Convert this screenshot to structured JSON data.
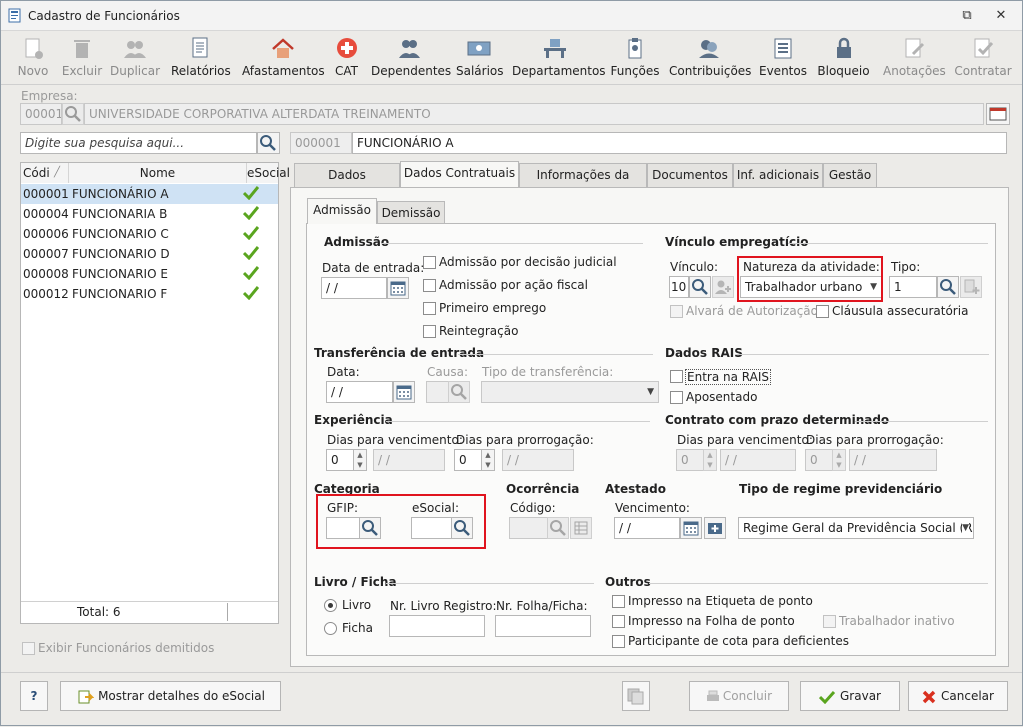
{
  "window": {
    "title": "Cadastro de Funcionários"
  },
  "toolbar": {
    "items": [
      {
        "label": "Novo",
        "icon": "new-icon",
        "enabled": false
      },
      {
        "label": "Excluir",
        "icon": "trash-icon",
        "enabled": false
      },
      {
        "label": "Duplicar",
        "icon": "duplicate-icon",
        "enabled": false
      },
      {
        "label": "Relatórios",
        "icon": "report-icon",
        "enabled": true
      },
      {
        "label": "Afastamentos",
        "icon": "house-icon",
        "enabled": true
      },
      {
        "label": "CAT",
        "icon": "cross-icon",
        "enabled": true
      },
      {
        "label": "Dependentes",
        "icon": "people-icon",
        "enabled": true
      },
      {
        "label": "Salários",
        "icon": "money-icon",
        "enabled": true
      },
      {
        "label": "Departamentos",
        "icon": "desk-icon",
        "enabled": true
      },
      {
        "label": "Funções",
        "icon": "badge-icon",
        "enabled": true
      },
      {
        "label": "Contribuições",
        "icon": "contribution-icon",
        "enabled": true
      },
      {
        "label": "Eventos",
        "icon": "list-icon",
        "enabled": true
      },
      {
        "label": "Bloqueio",
        "icon": "lock-icon",
        "enabled": true
      },
      {
        "label": "Anotações",
        "icon": "note-icon",
        "enabled": false
      },
      {
        "label": "Contratar",
        "icon": "hire-icon",
        "enabled": false
      }
    ]
  },
  "empresa": {
    "label": "Empresa:",
    "code": "00001",
    "name": "UNIVERSIDADE CORPORATIVA ALTERDATA TREINAMENTO"
  },
  "search": {
    "placeholder": "Digite sua pesquisa aqui..."
  },
  "employee": {
    "code": "000001",
    "name": "FUNCIONÁRIO A"
  },
  "grid": {
    "headers": [
      "Códi",
      "Nome",
      "eSocial"
    ],
    "rows": [
      {
        "code": "000001",
        "name": "FUNCIONÁRIO A",
        "esocial": true
      },
      {
        "code": "000004",
        "name": "FUNCIONARIA B",
        "esocial": true
      },
      {
        "code": "000006",
        "name": "FUNCIONARIO C",
        "esocial": true
      },
      {
        "code": "000007",
        "name": "FUNCIONARIO D",
        "esocial": true
      },
      {
        "code": "000008",
        "name": "FUNCIONARIO E",
        "esocial": true
      },
      {
        "code": "000012",
        "name": "FUNCIONARIO F",
        "esocial": true
      }
    ],
    "total": "Total: 6"
  },
  "exibir_demitidos": "Exibir Funcionários demitidos",
  "tabs": [
    "Dados Cadastrais",
    "Dados Contratuais",
    "Informações da folha",
    "Documentos",
    "Inf. adicionais",
    "Gestão"
  ],
  "subtabs": [
    "Admissão",
    "Demissão"
  ],
  "admissao": {
    "title": "Admissão",
    "data_label": "Data de entrada:",
    "date_value": " / /",
    "checks": [
      "Admissão por decisão judicial",
      "Admissão por ação fiscal",
      "Primeiro emprego",
      "Reintegração"
    ]
  },
  "vinculo": {
    "title": "Vínculo empregatício",
    "vinculo_label": "Vínculo:",
    "vinculo_value": "10",
    "natureza_label": "Natureza da atividade:",
    "natureza_value": "Trabalhador urbano",
    "tipo_label": "Tipo:",
    "tipo_value": "1",
    "alvara": "Alvará de Autorização",
    "clausula": "Cláusula assecuratória"
  },
  "transferencia": {
    "title": "Transferência de entrada",
    "data_label": "Data:",
    "date_value": " / /",
    "causa_label": "Causa:",
    "tipo_label": "Tipo de transferência:"
  },
  "rais": {
    "title": "Dados RAIS",
    "entra": "Entra na RAIS",
    "aposentado": "Aposentado"
  },
  "experiencia": {
    "title": "Experiência",
    "venc_label": "Dias para vencimento:",
    "prorr_label": "Dias para prorrogação:",
    "venc_value": "0",
    "venc_date": " / /",
    "prorr_value": "0",
    "prorr_date": " / /"
  },
  "contrato": {
    "title": "Contrato com prazo determinado",
    "venc_label": "Dias para vencimento:",
    "prorr_label": "Dias para prorrogação:",
    "venc_value": "0",
    "venc_date": " / /",
    "prorr_value": "0",
    "prorr_date": " / /"
  },
  "categoria": {
    "title": "Categoria",
    "gfip_label": "GFIP:",
    "esocial_label": "eSocial:"
  },
  "ocorrencia": {
    "title": "Ocorrência",
    "codigo_label": "Código:"
  },
  "atestado": {
    "title": "Atestado",
    "venc_label": "Vencimento:",
    "date_value": " / /"
  },
  "regime": {
    "title": "Tipo de regime previdenciário",
    "value": "Regime Geral da Previdência Social (RGP"
  },
  "livro": {
    "title": "Livro / Ficha",
    "livro": "Livro",
    "ficha": "Ficha",
    "nr_registro": "Nr. Livro Registro:",
    "nr_folha": "Nr. Folha/Ficha:"
  },
  "outros": {
    "title": "Outros",
    "impresso_etiqueta": "Impresso na Etiqueta de ponto",
    "impresso_folha": "Impresso na Folha de ponto",
    "participante": "Participante de cota para deficientes",
    "inativo": "Trabalhador inativo"
  },
  "bottom": {
    "help": "?",
    "mostrar": "Mostrar detalhes do eSocial",
    "concluir": "Concluir",
    "gravar": "Gravar",
    "cancelar": "Cancelar"
  },
  "colors": {
    "highlight": "#e0141e",
    "selected_row": "#cfe2f4",
    "check_green": "#5aa51f"
  }
}
